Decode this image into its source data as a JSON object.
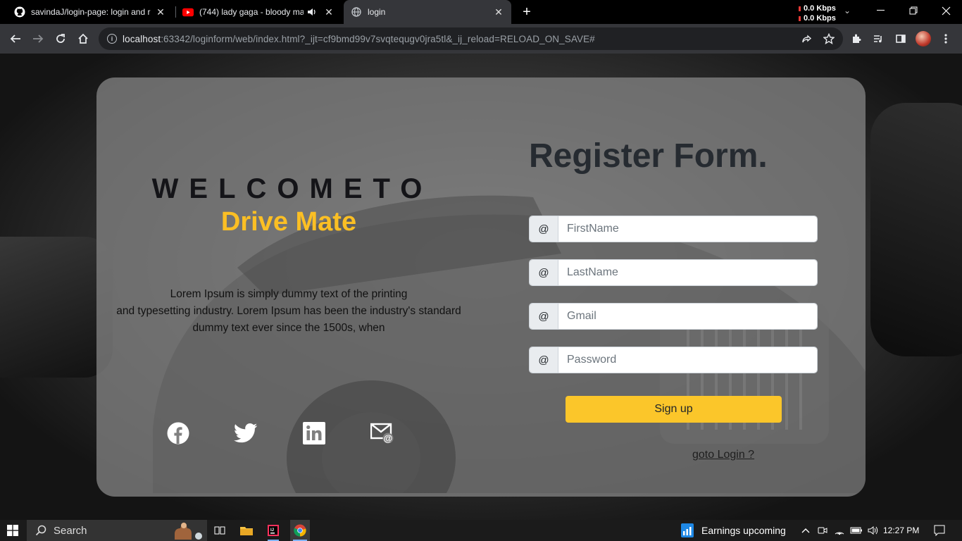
{
  "browser": {
    "tabs": [
      {
        "title": "savindaJ/login-page: login and r",
        "icon": "github-icon"
      },
      {
        "title": "(744) lady gaga - bloody ma",
        "icon": "youtube-icon"
      },
      {
        "title": "login",
        "icon": "globe-icon"
      }
    ],
    "network": {
      "upload": "0.0 Kbps",
      "download": "0.0 Kbps"
    },
    "address": {
      "host": "localhost",
      "rest": ":63342/loginform/web/index.html?_ijt=cf9bmd99v7svqtequgv0jra5tl&_ij_reload=RELOAD_ON_SAVE#"
    }
  },
  "welcome": {
    "heading": "WELCOMETO",
    "brand": "Drive Mate",
    "lorem_lines": [
      "Lorem Ipsum is simply dummy text of the printing",
      "and typesetting industry. Lorem Ipsum has been the industry's standard",
      "dummy text ever since the 1500s, when"
    ],
    "brand_color": "#fbbf24"
  },
  "social": [
    "facebook-icon",
    "twitter-icon",
    "linkedin-icon",
    "email-icon"
  ],
  "form": {
    "title": "Register Form.",
    "prefix": "@",
    "fields": {
      "first": "FirstName",
      "last": "LastName",
      "gmail": "Gmail",
      "password": "Password"
    },
    "signup_label": "Sign up",
    "goto_login": "goto Login ?",
    "button_color": "#fbc62a"
  },
  "taskbar": {
    "search_label": "Search",
    "news": "Earnings upcoming",
    "time": "12:27 PM"
  }
}
